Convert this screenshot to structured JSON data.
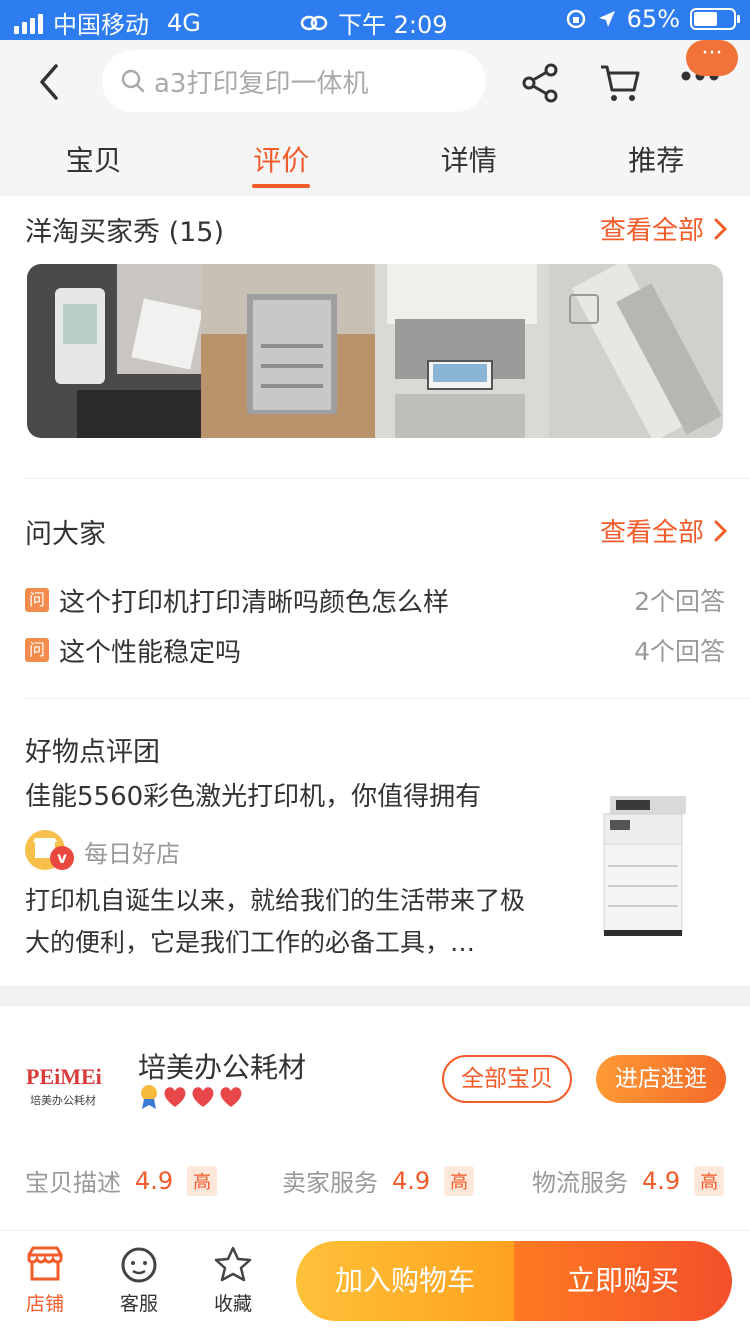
{
  "status_bar": {
    "carrier": "中国移动",
    "network": "4G",
    "time": "下午 2:09",
    "battery": "65%"
  },
  "nav": {
    "search_placeholder": "a3打印复印一体机",
    "badge": "···"
  },
  "tabs": [
    {
      "label": "宝贝",
      "active": false
    },
    {
      "label": "评价",
      "active": true
    },
    {
      "label": "详情",
      "active": false
    },
    {
      "label": "推荐",
      "active": false
    }
  ],
  "buyer_show": {
    "title": "洋淘买家秀 (15)",
    "view_all": "查看全部"
  },
  "ask": {
    "title": "问大家",
    "view_all": "查看全部",
    "badge": "问",
    "questions": [
      {
        "text": "这个打印机打印清晰吗颜色怎么样",
        "answers": "2个回答"
      },
      {
        "text": "这个性能稳定吗",
        "answers": "4个回答"
      }
    ]
  },
  "review_group": {
    "title": "好物点评团",
    "article_title": "佳能5560彩色激光打印机，你值得拥有",
    "shop": "每日好店",
    "verified": "v",
    "body": "打印机自诞生以来，就给我们的生活带来了极大的便利，它是我们工作的必备工具，…"
  },
  "store": {
    "logo": "PEiMEi",
    "logo_sub": "培美办公耗材",
    "name": "培美办公耗材",
    "all_items": "全部宝贝",
    "enter": "进店逛逛",
    "ratings": [
      {
        "label": "宝贝描述",
        "value": "4.9",
        "level": "高"
      },
      {
        "label": "卖家服务",
        "value": "4.9",
        "level": "高"
      },
      {
        "label": "物流服务",
        "value": "4.9",
        "level": "高"
      }
    ]
  },
  "bottom_bar": {
    "store": "店铺",
    "service": "客服",
    "favorite": "收藏",
    "add_cart": "加入购物车",
    "buy_now": "立即购买"
  },
  "colors": {
    "accent": "#f25b2a",
    "status_bar": "#2d7df0"
  }
}
